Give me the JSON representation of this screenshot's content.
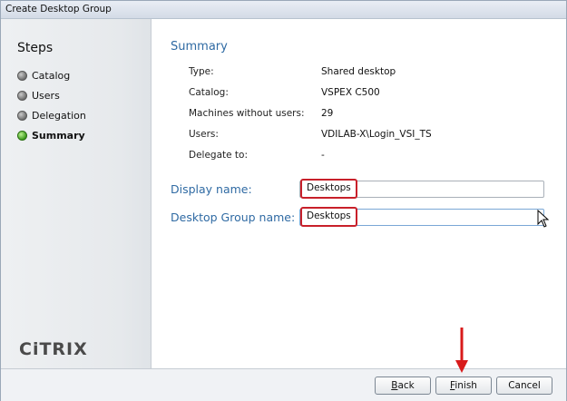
{
  "window": {
    "title": "Create Desktop Group"
  },
  "sidebar": {
    "title": "Steps",
    "steps": [
      {
        "label": "Catalog",
        "state": "inactive"
      },
      {
        "label": "Users",
        "state": "inactive"
      },
      {
        "label": "Delegation",
        "state": "inactive"
      },
      {
        "label": "Summary",
        "state": "active"
      }
    ],
    "logo_text": "CiTRIX"
  },
  "summary": {
    "title": "Summary",
    "rows": [
      {
        "label": "Type:",
        "value": "Shared desktop"
      },
      {
        "label": "Catalog:",
        "value": "VSPEX C500"
      },
      {
        "label": "Machines without users:",
        "value": "29"
      },
      {
        "label": "Users:",
        "value": "VDILAB-X\\Login_VSI_TS"
      },
      {
        "label": "Delegate to:",
        "value": "-"
      }
    ]
  },
  "form": {
    "display_name_label": "Display name:",
    "display_name_value": "Desktops",
    "group_name_label": "Desktop Group name:",
    "group_name_value": "Desktops"
  },
  "buttons": {
    "back": {
      "mnemonic": "B",
      "rest": "ack"
    },
    "finish": {
      "mnemonic": "F",
      "rest": "inish"
    },
    "cancel": "Cancel"
  },
  "colors": {
    "accent": "#2f6aa3",
    "highlight": "#c8202a",
    "active_step": "#3e9b1e"
  }
}
